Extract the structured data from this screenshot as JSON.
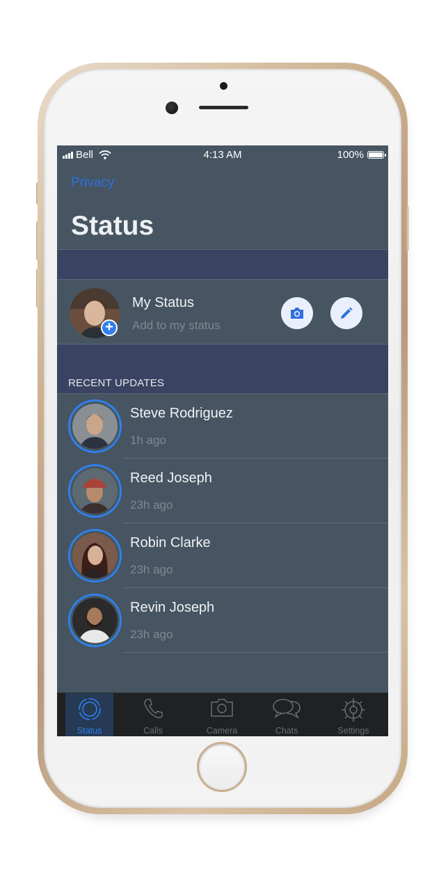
{
  "status_bar": {
    "carrier": "Bell",
    "time": "4:13 AM",
    "battery": "100%"
  },
  "header": {
    "back_link": "Privacy",
    "title": "Status"
  },
  "my_status": {
    "name": "My Status",
    "subtitle": "Add to my status",
    "camera_icon": "camera-icon",
    "edit_icon": "pencil-icon"
  },
  "recent": {
    "section_label": "RECENT UPDATES",
    "items": [
      {
        "name": "Steve Rodriguez",
        "time": "1h ago"
      },
      {
        "name": "Reed Joseph",
        "time": "23h ago"
      },
      {
        "name": "Robin Clarke",
        "time": "23h ago"
      },
      {
        "name": "Revin Joseph",
        "time": "23h ago"
      }
    ]
  },
  "tabs": [
    {
      "label": "Status",
      "icon": "status-icon",
      "active": true
    },
    {
      "label": "Calls",
      "icon": "phone-icon",
      "active": false
    },
    {
      "label": "Camera",
      "icon": "camera-icon",
      "active": false
    },
    {
      "label": "Chats",
      "icon": "chat-bubbles-icon",
      "active": false
    },
    {
      "label": "Settings",
      "icon": "gear-icon",
      "active": false
    }
  ],
  "colors": {
    "accent": "#2f80ed",
    "screen_bg": "#465561",
    "band_bg": "#3a4361",
    "tabbar_bg": "#1f2123"
  }
}
